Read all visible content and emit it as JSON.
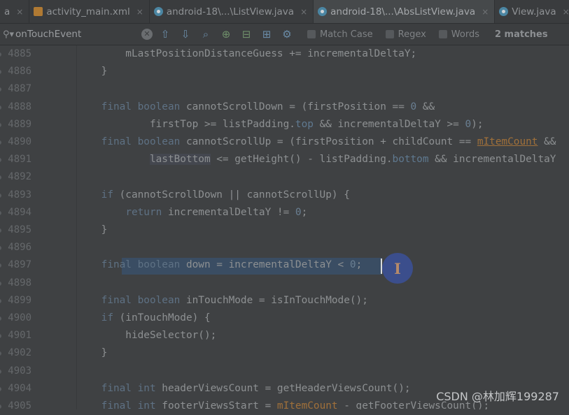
{
  "tabs": [
    {
      "label": "a",
      "kind": "partial",
      "active": false,
      "closable": true
    },
    {
      "label": "activity_main.xml",
      "kind": "xml",
      "active": false,
      "closable": true
    },
    {
      "label": "android-18\\...\\ListView.java",
      "kind": "java",
      "active": false,
      "closable": true
    },
    {
      "label": "android-18\\...\\AbsListView.java",
      "kind": "java",
      "active": true,
      "closable": true
    },
    {
      "label": "View.java",
      "kind": "java",
      "active": false,
      "closable": true
    }
  ],
  "search": {
    "query": "onTouchEvent",
    "toolbar_icons": [
      "arrow-up-icon",
      "arrow-down-icon",
      "find-all-icon",
      "add-occurrence-icon",
      "remove-occurrence-icon",
      "select-all-occurrences-icon",
      "settings-icon"
    ],
    "match_case_label": "Match Case",
    "regex_label": "Regex",
    "words_label": "Words",
    "match_count": "2 matches"
  },
  "gutter": {
    "line_numbers": [
      "4885",
      "4886",
      "4887",
      "4888",
      "4889",
      "4890",
      "4891",
      "4892",
      "4893",
      "4894",
      "4895",
      "4896",
      "4897",
      "4898",
      "4899",
      "4900",
      "4901",
      "4902",
      "4903",
      "4904",
      "4905"
    ]
  },
  "code_lines": [
    [
      [
        "",
        "        mLastPositionDistanceGuess += incrementalDeltaY;"
      ]
    ],
    [
      [
        "",
        "    }"
      ]
    ],
    [
      [
        "",
        ""
      ]
    ],
    [
      [
        "",
        "    "
      ],
      [
        "kw",
        "final boolean"
      ],
      [
        "",
        " cannotScrollDown = (firstPosition == "
      ],
      [
        "num",
        "0"
      ],
      [
        "",
        " &&"
      ]
    ],
    [
      [
        "",
        "            firstTop >= listPadding."
      ],
      [
        "fld",
        "top"
      ],
      [
        "",
        " && incrementalDeltaY >= "
      ],
      [
        "num",
        "0"
      ],
      [
        "",
        ");"
      ]
    ],
    [
      [
        "",
        "    "
      ],
      [
        "kw",
        "final boolean"
      ],
      [
        "",
        " cannotScrollUp = (firstPosition + childCount == "
      ],
      [
        "warn",
        "mItemCount"
      ],
      [
        "",
        " &&"
      ]
    ],
    [
      [
        "",
        "            "
      ],
      [
        "hl",
        "lastBottom"
      ],
      [
        "",
        " <= getHeight() - listPadding."
      ],
      [
        "fld",
        "bottom"
      ],
      [
        "",
        " && incrementalDeltaY"
      ]
    ],
    [
      [
        "",
        ""
      ]
    ],
    [
      [
        "",
        "    "
      ],
      [
        "kw",
        "if"
      ],
      [
        "",
        " (cannotScrollDown || cannotScrollUp) {"
      ]
    ],
    [
      [
        "",
        "        "
      ],
      [
        "kw",
        "return"
      ],
      [
        "",
        " incrementalDeltaY != "
      ],
      [
        "num",
        "0"
      ],
      [
        "",
        ";"
      ]
    ],
    [
      [
        "",
        "    }"
      ]
    ],
    [
      [
        "",
        ""
      ]
    ],
    [
      [
        "",
        "    "
      ],
      [
        "kw",
        "final boolean"
      ],
      [
        "",
        " down = incrementalDeltaY < "
      ],
      [
        "num",
        "0"
      ],
      [
        "",
        ";"
      ]
    ],
    [
      [
        "",
        ""
      ]
    ],
    [
      [
        "",
        "    "
      ],
      [
        "kw",
        "final boolean"
      ],
      [
        "",
        " inTouchMode = isInTouchMode();"
      ]
    ],
    [
      [
        "",
        "    "
      ],
      [
        "kw",
        "if"
      ],
      [
        "",
        " (inTouchMode) {"
      ]
    ],
    [
      [
        "",
        "        hideSelector();"
      ]
    ],
    [
      [
        "",
        "    }"
      ]
    ],
    [
      [
        "",
        ""
      ]
    ],
    [
      [
        "",
        "    "
      ],
      [
        "kw",
        "final int"
      ],
      [
        "",
        " headerViewsCount = getHeaderViewsCount();"
      ]
    ],
    [
      [
        "",
        "    "
      ],
      [
        "kw",
        "final int"
      ],
      [
        "",
        " footerViewsStart = "
      ],
      [
        "warn",
        "mItemCount"
      ],
      [
        "",
        " - getFooterViewsCount();"
      ]
    ]
  ],
  "cursor_glyph": "I",
  "watermark": "CSDN @林加辉199287"
}
